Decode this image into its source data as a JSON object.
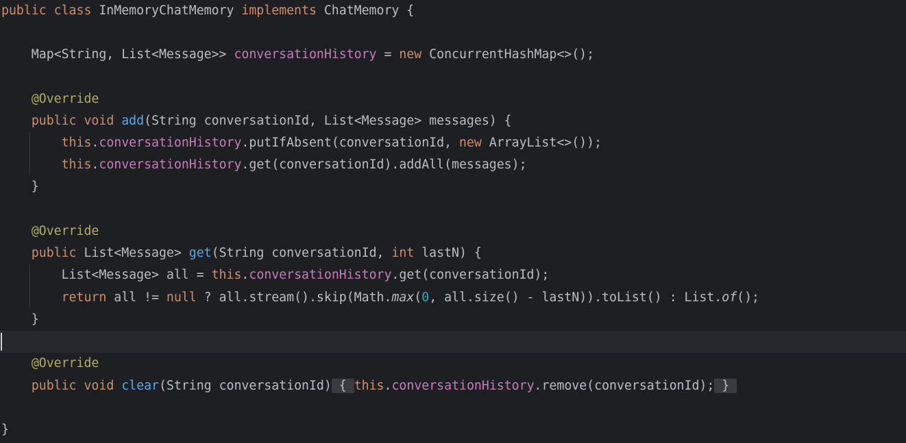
{
  "editor": {
    "language": "java",
    "colors": {
      "background": "#1e1f22",
      "current_line": "#26282e",
      "keyword": "#cf8e6d",
      "field": "#c77dbb",
      "method": "#56a8f5",
      "annotation": "#b3ae60",
      "number": "#2aacb8",
      "text": "#bcbec4"
    },
    "lines": [
      [
        {
          "t": "public",
          "c": "kw"
        },
        {
          "t": " "
        },
        {
          "t": "class",
          "c": "kw"
        },
        {
          "t": " InMemoryChatMemory "
        },
        {
          "t": "implements",
          "c": "kw"
        },
        {
          "t": " ChatMemory {"
        }
      ],
      [],
      [
        {
          "t": "    Map<String, List<Message>> "
        },
        {
          "t": "conversationHistory",
          "c": "fld"
        },
        {
          "t": " = "
        },
        {
          "t": "new",
          "c": "kw"
        },
        {
          "t": " ConcurrentHashMap<>();"
        }
      ],
      [],
      [
        {
          "t": "    "
        },
        {
          "t": "@Override",
          "c": "ann"
        }
      ],
      [
        {
          "t": "    "
        },
        {
          "t": "public",
          "c": "kw"
        },
        {
          "t": " "
        },
        {
          "t": "void",
          "c": "kw"
        },
        {
          "t": " "
        },
        {
          "t": "add",
          "c": "fn"
        },
        {
          "t": "(String conversationId, List<Message> messages) {"
        }
      ],
      [
        {
          "t": "        "
        },
        {
          "t": "this",
          "c": "kw"
        },
        {
          "t": "."
        },
        {
          "t": "conversationHistory",
          "c": "fld"
        },
        {
          "t": ".putIfAbsent(conversationId, "
        },
        {
          "t": "new",
          "c": "kw"
        },
        {
          "t": " ArrayList<>());"
        }
      ],
      [
        {
          "t": "        "
        },
        {
          "t": "this",
          "c": "kw"
        },
        {
          "t": "."
        },
        {
          "t": "conversationHistory",
          "c": "fld"
        },
        {
          "t": ".get(conversationId).addAll(messages);"
        }
      ],
      [
        {
          "t": "    }"
        }
      ],
      [],
      [
        {
          "t": "    "
        },
        {
          "t": "@Override",
          "c": "ann"
        }
      ],
      [
        {
          "t": "    "
        },
        {
          "t": "public",
          "c": "kw"
        },
        {
          "t": " List<Message> "
        },
        {
          "t": "get",
          "c": "fn"
        },
        {
          "t": "(String conversationId, "
        },
        {
          "t": "int",
          "c": "kw"
        },
        {
          "t": " lastN) {"
        }
      ],
      [
        {
          "t": "        List<Message> all = "
        },
        {
          "t": "this",
          "c": "kw"
        },
        {
          "t": "."
        },
        {
          "t": "conversationHistory",
          "c": "fld"
        },
        {
          "t": ".get(conversationId);"
        }
      ],
      [
        {
          "t": "        "
        },
        {
          "t": "return",
          "c": "kw"
        },
        {
          "t": " all != "
        },
        {
          "t": "null",
          "c": "kw"
        },
        {
          "t": " ? all.stream().skip(Math."
        },
        {
          "t": "max",
          "c": "ital"
        },
        {
          "t": "("
        },
        {
          "t": "0",
          "c": "num"
        },
        {
          "t": ", all.size() - lastN)).toList() : List."
        },
        {
          "t": "of",
          "c": "ital"
        },
        {
          "t": "();"
        }
      ],
      [
        {
          "t": "    }"
        }
      ],
      [],
      [
        {
          "t": "    "
        },
        {
          "t": "@Override",
          "c": "ann"
        }
      ],
      [
        {
          "t": "    "
        },
        {
          "t": "public",
          "c": "kw"
        },
        {
          "t": " "
        },
        {
          "t": "void",
          "c": "kw"
        },
        {
          "t": " "
        },
        {
          "t": "clear",
          "c": "fn"
        },
        {
          "t": "(String conversationId)"
        },
        {
          "t": " { ",
          "c": "fold"
        },
        {
          "t": "this",
          "c": "kw"
        },
        {
          "t": "."
        },
        {
          "t": "conversationHistory",
          "c": "fld"
        },
        {
          "t": ".remove(conversationId);"
        },
        {
          "t": " } ",
          "c": "fold"
        }
      ],
      [],
      [
        {
          "t": "}"
        }
      ]
    ]
  }
}
